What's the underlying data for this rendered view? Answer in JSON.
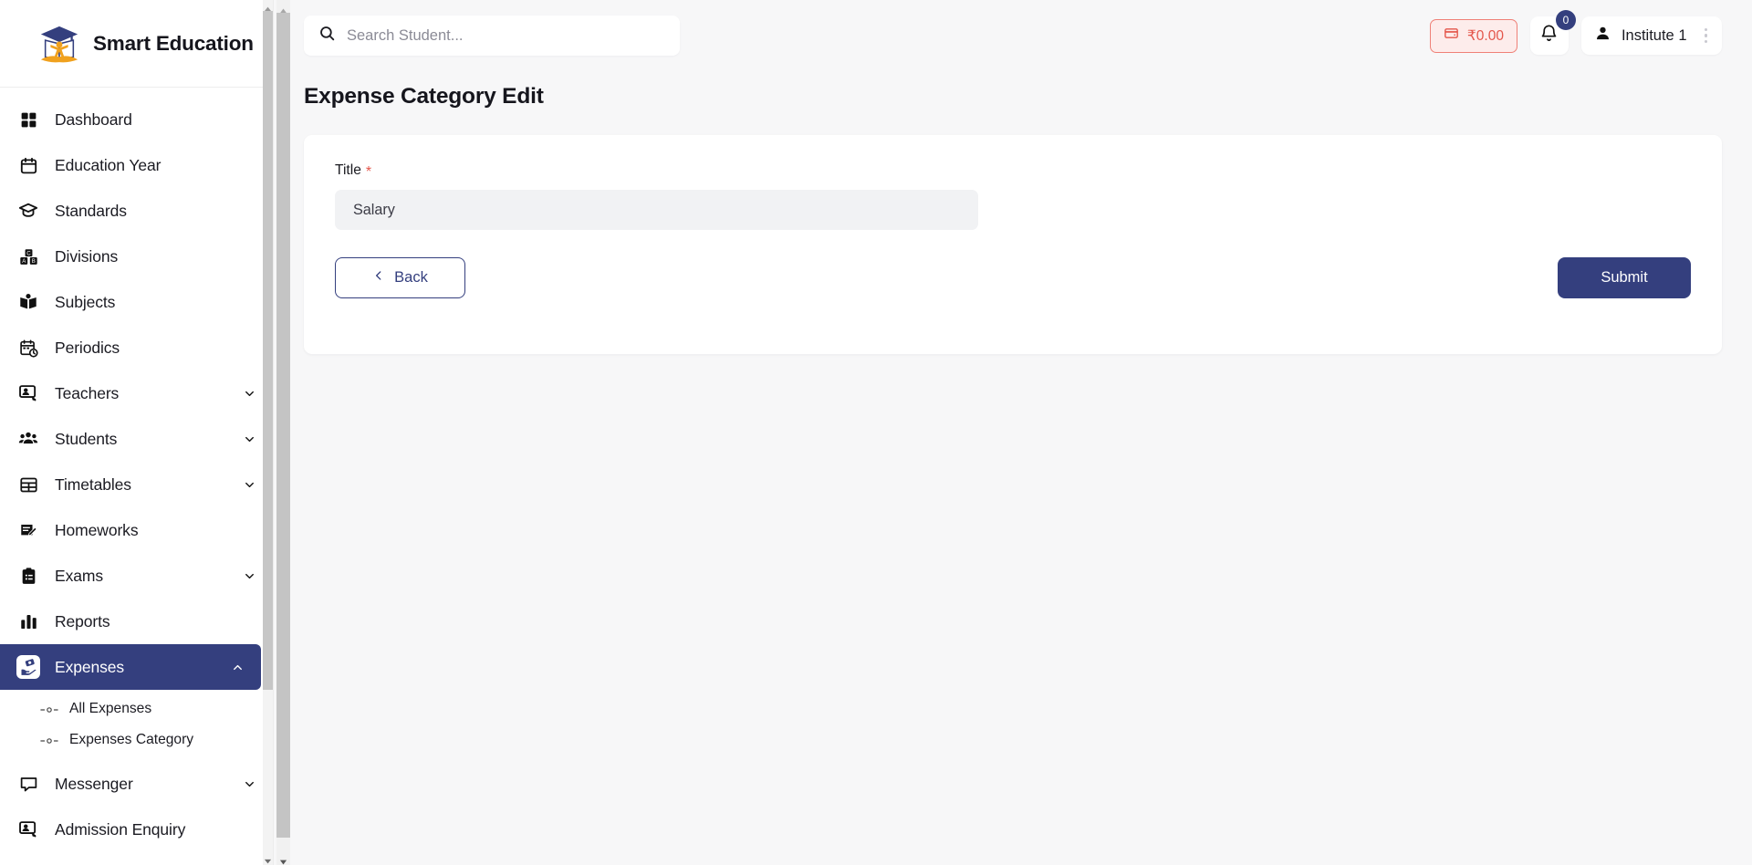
{
  "brand": {
    "name": "Smart Education",
    "logo_icon": "graduation-cap-book-logo"
  },
  "sidebar": {
    "items": [
      {
        "label": "Dashboard",
        "icon": "grid-squares-icon",
        "expandable": false,
        "active": false
      },
      {
        "label": "Education Year",
        "icon": "calendar-icon",
        "expandable": false,
        "active": false
      },
      {
        "label": "Standards",
        "icon": "graduation-cap-icon",
        "expandable": false,
        "active": false
      },
      {
        "label": "Divisions",
        "icon": "blocks-abc-icon",
        "expandable": false,
        "active": false
      },
      {
        "label": "Subjects",
        "icon": "open-book-icon",
        "expandable": false,
        "active": false
      },
      {
        "label": "Periodics",
        "icon": "calendar-clock-icon",
        "expandable": false,
        "active": false
      },
      {
        "label": "Teachers",
        "icon": "presentation-user-icon",
        "expandable": true,
        "active": false
      },
      {
        "label": "Students",
        "icon": "users-group-icon",
        "expandable": true,
        "active": false
      },
      {
        "label": "Timetables",
        "icon": "table-grid-icon",
        "expandable": true,
        "active": false
      },
      {
        "label": "Homeworks",
        "icon": "document-pencil-icon",
        "expandable": false,
        "active": false
      },
      {
        "label": "Exams",
        "icon": "clipboard-list-icon",
        "expandable": true,
        "active": false
      },
      {
        "label": "Reports",
        "icon": "bar-chart-icon",
        "expandable": false,
        "active": false
      },
      {
        "label": "Expenses",
        "icon": "hand-money-icon",
        "expandable": true,
        "active": true
      },
      {
        "label": "Messenger",
        "icon": "chat-bubble-icon",
        "expandable": true,
        "active": false
      },
      {
        "label": "Admission Enquiry",
        "icon": "presentation-user-icon",
        "expandable": false,
        "active": false
      }
    ],
    "expenses_submenu": [
      {
        "label": "All Expenses",
        "bullet_icon": "dash-circle-dash-icon"
      },
      {
        "label": "Expenses Category",
        "bullet_icon": "dash-circle-dash-icon"
      }
    ]
  },
  "topbar": {
    "search": {
      "placeholder": "Search Student...",
      "value": "",
      "icon": "search-icon"
    },
    "wallet": {
      "amount": "₹0.00",
      "icon": "wallet-icon"
    },
    "notifications": {
      "count": "0",
      "icon": "bell-icon"
    },
    "profile": {
      "name": "Institute 1",
      "icon": "user-icon",
      "menu_icon": "kebab-vertical-icon"
    }
  },
  "page": {
    "title": "Expense Category Edit",
    "form": {
      "title_field": {
        "label": "Title",
        "required_marker": "*",
        "value": "Salary",
        "placeholder": ""
      },
      "back_button": {
        "label": "Back",
        "icon": "chevron-left-icon"
      },
      "submit_button": {
        "label": "Submit"
      }
    }
  },
  "colors": {
    "navy": "#343f7e",
    "accent_red": "#e4564b",
    "wallet_bg": "#fdeceb",
    "page_bg": "#f7f7f8",
    "input_bg": "#f1f2f4",
    "logo_orange": "#f0a11e"
  }
}
